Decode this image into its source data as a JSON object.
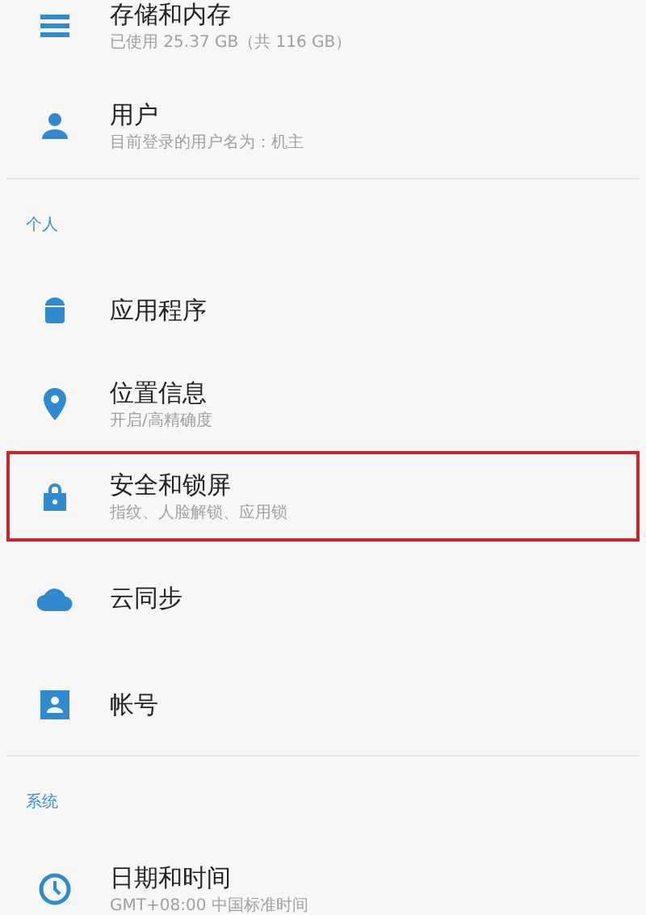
{
  "sections": [
    {
      "items": [
        {
          "title": "存储和内存",
          "subtitle": "已使用 25.37 GB（共 116 GB）",
          "highlighted": false
        },
        {
          "title": "用户",
          "subtitle": "目前登录的用户名为：机主",
          "highlighted": false
        }
      ]
    },
    {
      "header": "个人",
      "items": [
        {
          "title": "应用程序",
          "highlighted": false
        },
        {
          "title": "位置信息",
          "subtitle": "开启/高精确度",
          "highlighted": false
        },
        {
          "title": "安全和锁屏",
          "subtitle": "指纹、人脸解锁、应用锁",
          "highlighted": true
        },
        {
          "title": "云同步",
          "highlighted": false
        },
        {
          "title": "帐号",
          "highlighted": false
        }
      ]
    },
    {
      "header": "系统",
      "items": [
        {
          "title": "日期和时间",
          "subtitle": "GMT+08:00 中国标准时间",
          "highlighted": false
        }
      ]
    }
  ]
}
